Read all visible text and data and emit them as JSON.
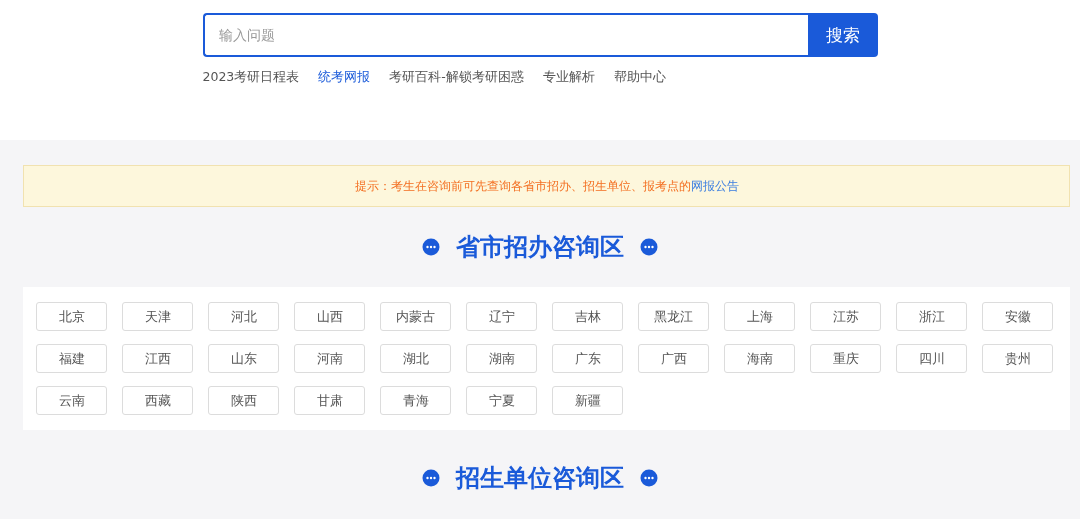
{
  "search": {
    "placeholder": "输入问题",
    "button": "搜索"
  },
  "quick_links": [
    {
      "label": "2023考研日程表",
      "selected": false
    },
    {
      "label": "统考网报",
      "selected": true
    },
    {
      "label": "考研百科-解锁考研困惑",
      "selected": false
    },
    {
      "label": "专业解析",
      "selected": false
    },
    {
      "label": "帮助中心",
      "selected": false
    }
  ],
  "notice": {
    "text": "提示：考生在咨询前可先查询各省市招办、招生单位、报考点的",
    "link": "网报公告"
  },
  "sections": [
    {
      "title": "省市招办咨询区",
      "regions": [
        "北京",
        "天津",
        "河北",
        "山西",
        "内蒙古",
        "辽宁",
        "吉林",
        "黑龙江",
        "上海",
        "江苏",
        "浙江",
        "安徽",
        "福建",
        "江西",
        "山东",
        "河南",
        "湖北",
        "湖南",
        "广东",
        "广西",
        "海南",
        "重庆",
        "四川",
        "贵州",
        "云南",
        "西藏",
        "陕西",
        "甘肃",
        "青海",
        "宁夏",
        "新疆"
      ]
    },
    {
      "title": "招生单位咨询区"
    }
  ]
}
